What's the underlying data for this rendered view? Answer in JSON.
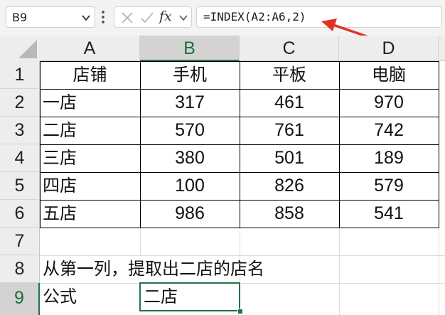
{
  "formula_bar": {
    "name_box": "B9",
    "fx_label": "fx",
    "formula": "=INDEX(A2:A6,2)"
  },
  "icons": {
    "name_box_dropdown": "chevron-down-icon",
    "more": "vertical-dots-icon",
    "cancel": "cancel-x-icon",
    "enter": "check-icon",
    "fx_dropdown": "chevron-down-icon",
    "annotation": "red-arrow-icon",
    "select_all": "select-all-triangle-icon"
  },
  "colors": {
    "selection_green": "#217346",
    "annotation_red": "#e03326",
    "header_bg": "#ededed"
  },
  "sheet": {
    "columns": [
      "A",
      "B",
      "C",
      "D"
    ],
    "rows": [
      "1",
      "2",
      "3",
      "4",
      "5",
      "6",
      "7",
      "8",
      "9"
    ],
    "table": {
      "headers": [
        "店铺",
        "手机",
        "平板",
        "电脑"
      ],
      "rows": [
        [
          "一店",
          "317",
          "461",
          "970"
        ],
        [
          "二店",
          "570",
          "761",
          "742"
        ],
        [
          "三店",
          "380",
          "501",
          "189"
        ],
        [
          "四店",
          "100",
          "826",
          "579"
        ],
        [
          "五店",
          "986",
          "858",
          "541"
        ]
      ]
    },
    "a8": "从第一列，提取出二店的店名",
    "a9": "公式",
    "b9": "二店",
    "active_cell": "B9"
  }
}
